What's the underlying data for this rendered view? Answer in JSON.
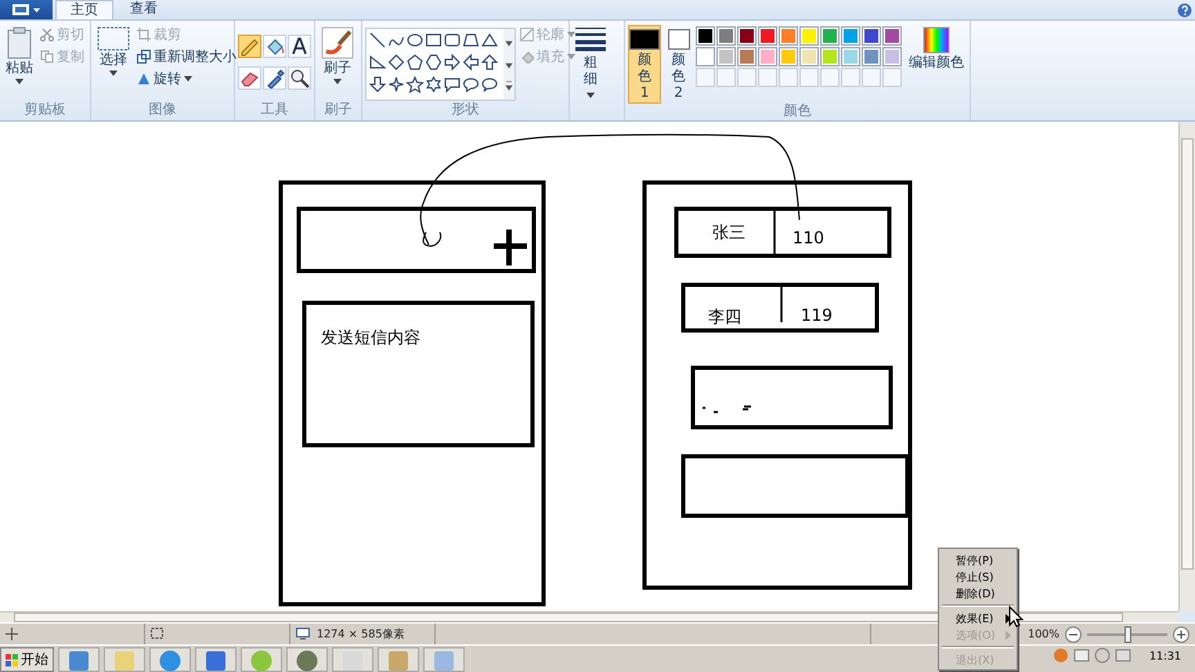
{
  "tabs": [
    {
      "label": "主页",
      "selected": true
    },
    {
      "label": "查看",
      "selected": false
    }
  ],
  "clipboard": {
    "paste": "粘贴",
    "cut": "剪切",
    "copy": "复制",
    "label": "剪贴板"
  },
  "image": {
    "select": "选择",
    "crop": "裁剪",
    "resize": "重新调整大小",
    "rotate": "旋转",
    "label": "图像"
  },
  "tools": {
    "label": "工具",
    "items": [
      {
        "kind": "pencil",
        "selected": true
      },
      {
        "kind": "fill",
        "selected": false
      },
      {
        "kind": "text",
        "selected": false
      },
      {
        "kind": "eraser",
        "selected": false
      },
      {
        "kind": "picker",
        "selected": false
      },
      {
        "kind": "magnifier",
        "selected": false
      }
    ]
  },
  "brushes": {
    "button": "刷子",
    "label": "刷子"
  },
  "shapes": {
    "label": "形状",
    "outline": "轮廓",
    "fill": "填充"
  },
  "size": {
    "label": "粗细"
  },
  "colors": {
    "label": "颜色",
    "edit": "编辑颜色",
    "slots": [
      {
        "label": "颜色 1",
        "color": "#000000",
        "selected": true
      },
      {
        "label": "颜色 2",
        "color": "#ffffff",
        "selected": false
      }
    ],
    "palette": [
      {
        "color": "#000000"
      },
      {
        "color": "#7f7f7f"
      },
      {
        "color": "#880015"
      },
      {
        "color": "#ed1c24"
      },
      {
        "color": "#ff7f27"
      },
      {
        "color": "#fff200"
      },
      {
        "color": "#22b14c"
      },
      {
        "color": "#00a2e8"
      },
      {
        "color": "#3f48cc"
      },
      {
        "color": "#a349a4"
      },
      {
        "color": "#ffffff"
      },
      {
        "color": "#c3c3c3"
      },
      {
        "color": "#b97a57"
      },
      {
        "color": "#ffaec9"
      },
      {
        "color": "#ffc90e"
      },
      {
        "color": "#efe4b0"
      },
      {
        "color": "#b5e61d"
      },
      {
        "color": "#99d9ea"
      },
      {
        "color": "#7092be"
      },
      {
        "color": "#c8bfe7"
      },
      {
        "kind": "empty"
      },
      {
        "kind": "empty"
      },
      {
        "kind": "empty"
      },
      {
        "kind": "empty"
      },
      {
        "kind": "empty"
      },
      {
        "kind": "empty"
      },
      {
        "kind": "empty"
      },
      {
        "kind": "empty"
      },
      {
        "kind": "empty"
      },
      {
        "kind": "empty"
      }
    ]
  },
  "drawing": {
    "texts": [
      "发送短信内容",
      "张三",
      "110",
      "李四",
      "119"
    ]
  },
  "status_bar": {
    "size": "1274 × 585像素",
    "zoom": "100%",
    "zoom_level": {
      "level": 0.5
    }
  },
  "context_menu": [
    {
      "kind": "item",
      "label": "暂停(P)",
      "disabled": false
    },
    {
      "kind": "item",
      "label": "停止(S)",
      "disabled": false
    },
    {
      "kind": "item",
      "label": "删除(D)",
      "disabled": false
    },
    {
      "kind": "separator"
    },
    {
      "kind": "submenu",
      "label": "效果(E)",
      "disabled": false
    },
    {
      "kind": "submenu",
      "label": "选项(O)",
      "disabled": true
    },
    {
      "kind": "separator"
    },
    {
      "kind": "item",
      "label": "退出(X)",
      "disabled": true
    }
  ],
  "taskbar": {
    "start": "开始",
    "clock": "11:31"
  }
}
